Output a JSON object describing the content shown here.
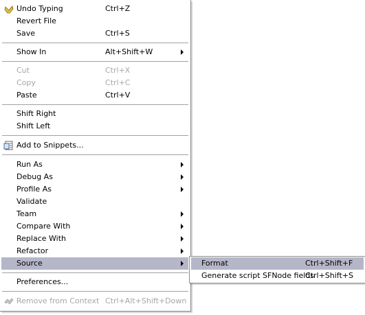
{
  "menu": {
    "undo": {
      "label": "Undo Typing",
      "shortcut": "Ctrl+Z"
    },
    "revert": {
      "label": "Revert File"
    },
    "save": {
      "label": "Save",
      "shortcut": "Ctrl+S"
    },
    "show_in": {
      "label": "Show In",
      "shortcut": "Alt+Shift+W"
    },
    "cut": {
      "label": "Cut",
      "shortcut": "Ctrl+X"
    },
    "copy": {
      "label": "Copy",
      "shortcut": "Ctrl+C"
    },
    "paste": {
      "label": "Paste",
      "shortcut": "Ctrl+V"
    },
    "shift_right": {
      "label": "Shift Right"
    },
    "shift_left": {
      "label": "Shift Left"
    },
    "snippets": {
      "label": "Add to Snippets..."
    },
    "run_as": {
      "label": "Run As"
    },
    "debug_as": {
      "label": "Debug As"
    },
    "profile_as": {
      "label": "Profile As"
    },
    "validate": {
      "label": "Validate"
    },
    "team": {
      "label": "Team"
    },
    "compare_with": {
      "label": "Compare With"
    },
    "replace_with": {
      "label": "Replace With"
    },
    "refactor": {
      "label": "Refactor"
    },
    "source": {
      "label": "Source"
    },
    "preferences": {
      "label": "Preferences..."
    },
    "remove_context": {
      "label": "Remove from Context",
      "shortcut": "Ctrl+Alt+Shift+Down"
    }
  },
  "submenu": {
    "format": {
      "label": "Format",
      "shortcut": "Ctrl+Shift+F"
    },
    "generate": {
      "label": "Generate script SFNode fields",
      "shortcut": "Ctrl+Shift+S"
    }
  },
  "colors": {
    "highlight": "#b6b6c9",
    "disabled_text": "#a7a6aa",
    "separator": "#a0a0a0"
  }
}
